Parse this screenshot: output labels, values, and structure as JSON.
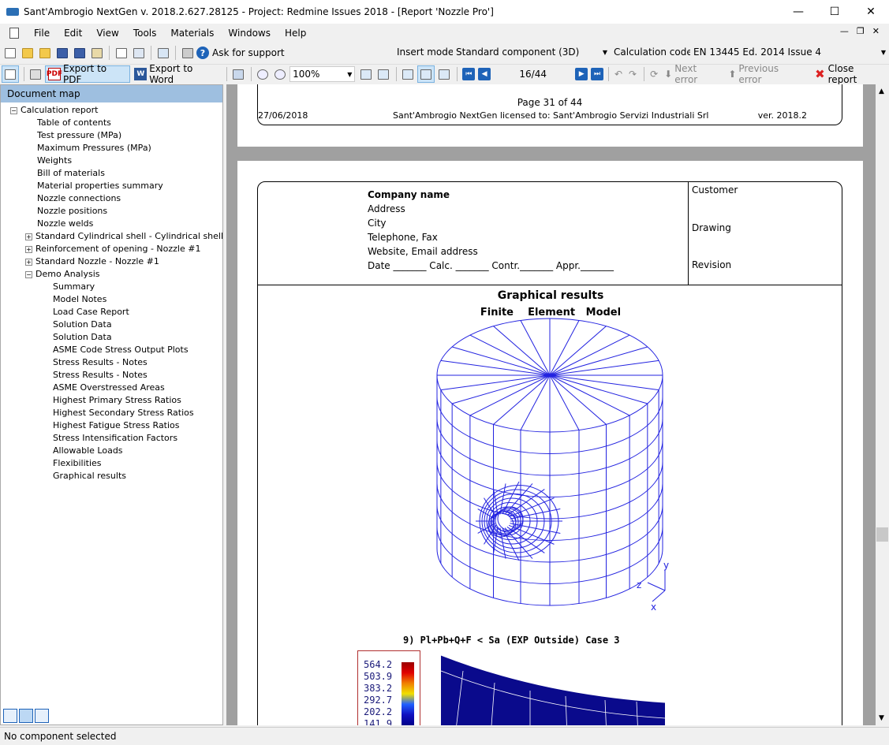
{
  "window": {
    "title": "Sant'Ambrogio NextGen v. 2018.2.627.28125 - Project: Redmine Issues 2018 - [Report 'Nozzle Pro']"
  },
  "menu": [
    "File",
    "Edit",
    "View",
    "Tools",
    "Materials",
    "Windows",
    "Help"
  ],
  "toolbar": {
    "support_label": "Ask for support",
    "insert_mode_label": "Insert mode:",
    "insert_mode_value": "Standard component (3D)",
    "calc_code_label": "Calculation code:",
    "calc_code_value": "EN 13445 Ed. 2014 Issue 4"
  },
  "report_toolbar": {
    "export_pdf": "Export to PDF",
    "export_word": "Export to Word",
    "zoom": "100%",
    "page": "16/44",
    "next_error": "Next error",
    "previous_error": "Previous error",
    "close_report": "Close report"
  },
  "sidebar": {
    "title": "Document map",
    "items": [
      {
        "label": "Calculation report",
        "level": 0,
        "expander": "−"
      },
      {
        "label": "Table of contents",
        "level": 1,
        "expander": ""
      },
      {
        "label": "Test pressure (MPa)",
        "level": 1,
        "expander": ""
      },
      {
        "label": "Maximum Pressures (MPa)",
        "level": 1,
        "expander": ""
      },
      {
        "label": "Weights",
        "level": 1,
        "expander": ""
      },
      {
        "label": "Bill of materials",
        "level": 1,
        "expander": ""
      },
      {
        "label": "Material properties summary",
        "level": 1,
        "expander": ""
      },
      {
        "label": "Nozzle connections",
        "level": 1,
        "expander": ""
      },
      {
        "label": "Nozzle positions",
        "level": 1,
        "expander": ""
      },
      {
        "label": "Nozzle welds",
        "level": 1,
        "expander": ""
      },
      {
        "label": "Standard Cylindrical shell - Cylindrical shell #1",
        "level": 1,
        "expander": "+"
      },
      {
        "label": "Reinforcement of opening - Nozzle #1",
        "level": 1,
        "expander": "+"
      },
      {
        "label": "Standard Nozzle - Nozzle #1",
        "level": 1,
        "expander": "+"
      },
      {
        "label": "Demo Analysis",
        "level": 1,
        "expander": "−"
      },
      {
        "label": "Summary",
        "level": 2,
        "expander": ""
      },
      {
        "label": "Model Notes",
        "level": 2,
        "expander": ""
      },
      {
        "label": "Load Case Report",
        "level": 2,
        "expander": ""
      },
      {
        "label": "Solution Data",
        "level": 2,
        "expander": ""
      },
      {
        "label": "Solution Data",
        "level": 2,
        "expander": ""
      },
      {
        "label": "ASME Code Stress Output Plots",
        "level": 2,
        "expander": ""
      },
      {
        "label": "Stress Results - Notes",
        "level": 2,
        "expander": ""
      },
      {
        "label": "Stress Results - Notes",
        "level": 2,
        "expander": ""
      },
      {
        "label": "ASME Overstressed Areas",
        "level": 2,
        "expander": ""
      },
      {
        "label": "Highest Primary Stress Ratios",
        "level": 2,
        "expander": ""
      },
      {
        "label": "Highest Secondary Stress Ratios",
        "level": 2,
        "expander": ""
      },
      {
        "label": "Highest Fatigue Stress Ratios",
        "level": 2,
        "expander": ""
      },
      {
        "label": "Stress Intensification Factors",
        "level": 2,
        "expander": ""
      },
      {
        "label": "Allowable Loads",
        "level": 2,
        "expander": ""
      },
      {
        "label": "Flexibilities",
        "level": 2,
        "expander": ""
      },
      {
        "label": "Graphical results",
        "level": 2,
        "expander": ""
      }
    ]
  },
  "page_footer": {
    "page_text": "Page 31 of 44",
    "date": "27/06/2018",
    "license": "Sant'Ambrogio NextGen licensed to: Sant'Ambrogio Servizi Industriali Srl",
    "version": "ver. 2018.2"
  },
  "page_header": {
    "company_name": "Company name",
    "address": "Address",
    "city": "City",
    "phone": "Telephone, Fax",
    "web": "Website, Email address",
    "signatures": "Date _______ Calc. _______ Contr._______ Appr._______",
    "customer": "Customer",
    "drawing": "Drawing",
    "revision": "Revision"
  },
  "graphics": {
    "title": "Graphical results",
    "subtitle": "Finite    Element   Model",
    "axis_y": "y",
    "axis_z": "z",
    "axis_x": "x",
    "caption": "9) Pl+Pb+Q+F < Sa (EXP Outside) Case 3",
    "legend_values": [
      "564.2",
      "503.9",
      "383.2",
      "292.7",
      "202.2",
      "141.9"
    ],
    "mesh_color": "#2323e0"
  },
  "status": "No component selected"
}
